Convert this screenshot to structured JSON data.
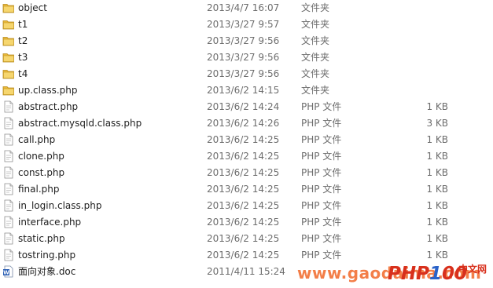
{
  "files": [
    {
      "name": "object",
      "date": "2013/4/7 16:07",
      "type": "文件夹",
      "size": "",
      "icon": "folder-icon"
    },
    {
      "name": "t1",
      "date": "2013/3/27 9:57",
      "type": "文件夹",
      "size": "",
      "icon": "folder-icon"
    },
    {
      "name": "t2",
      "date": "2013/3/27 9:56",
      "type": "文件夹",
      "size": "",
      "icon": "folder-icon"
    },
    {
      "name": "t3",
      "date": "2013/3/27 9:56",
      "type": "文件夹",
      "size": "",
      "icon": "folder-icon"
    },
    {
      "name": "t4",
      "date": "2013/3/27 9:56",
      "type": "文件夹",
      "size": "",
      "icon": "folder-icon"
    },
    {
      "name": "up.class.php",
      "date": "2013/6/2 14:15",
      "type": "文件夹",
      "size": "",
      "icon": "folder-icon"
    },
    {
      "name": "abstract.php",
      "date": "2013/6/2 14:24",
      "type": "PHP 文件",
      "size": "1 KB",
      "icon": "php-file-icon"
    },
    {
      "name": "abstract.mysqld.class.php",
      "date": "2013/6/2 14:26",
      "type": "PHP 文件",
      "size": "3 KB",
      "icon": "php-file-icon"
    },
    {
      "name": "call.php",
      "date": "2013/6/2 14:25",
      "type": "PHP 文件",
      "size": "1 KB",
      "icon": "php-file-icon"
    },
    {
      "name": "clone.php",
      "date": "2013/6/2 14:25",
      "type": "PHP 文件",
      "size": "1 KB",
      "icon": "php-file-icon"
    },
    {
      "name": "const.php",
      "date": "2013/6/2 14:25",
      "type": "PHP 文件",
      "size": "1 KB",
      "icon": "php-file-icon"
    },
    {
      "name": "final.php",
      "date": "2013/6/2 14:25",
      "type": "PHP 文件",
      "size": "1 KB",
      "icon": "php-file-icon"
    },
    {
      "name": "in_login.class.php",
      "date": "2013/6/2 14:25",
      "type": "PHP 文件",
      "size": "1 KB",
      "icon": "php-file-icon"
    },
    {
      "name": "interface.php",
      "date": "2013/6/2 14:25",
      "type": "PHP 文件",
      "size": "1 KB",
      "icon": "php-file-icon"
    },
    {
      "name": "static.php",
      "date": "2013/6/2 14:25",
      "type": "PHP 文件",
      "size": "1 KB",
      "icon": "php-file-icon"
    },
    {
      "name": "tostring.php",
      "date": "2013/6/2 14:25",
      "type": "PHP 文件",
      "size": "1 KB",
      "icon": "php-file-icon"
    },
    {
      "name": "面向对象.doc",
      "date": "2011/4/11 15:24",
      "type": "",
      "size": "",
      "icon": "word-doc-icon"
    }
  ],
  "watermark": {
    "url": "www.gaodaima.com",
    "logo_main": "PHP",
    "logo_highlight": "1",
    "logo_tail": "00",
    "logo_cn": "中文网"
  },
  "colors": {
    "folder": "#e8b738",
    "text": "#1e1e1e",
    "meta_text": "#6d6d6d",
    "watermark_orange": "#f05a14",
    "logo_red": "#d8301c",
    "logo_blue": "#2a62c9"
  }
}
